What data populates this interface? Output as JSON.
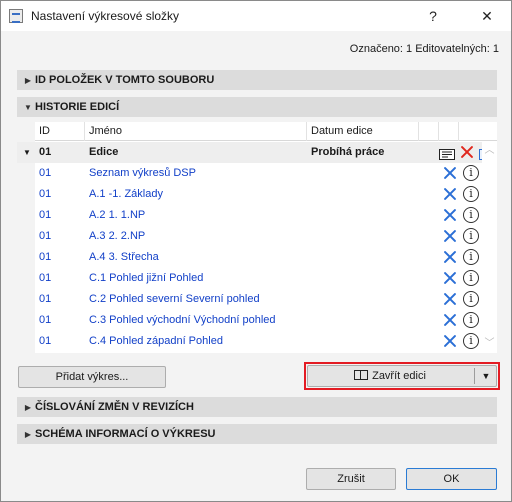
{
  "window": {
    "title": "Nastavení výkresové složky",
    "help_label": "?",
    "close_label": "✕"
  },
  "status": {
    "counts": "Označeno: 1 Editovatelných: 1"
  },
  "sections": {
    "id_items": "ID POLOŽEK V TOMTO SOUBORU",
    "history": "HISTORIE EDICÍ",
    "numbering": "ČÍSLOVÁNÍ ZMĚN V REVIZÍCH",
    "schema": "SCHÉMA INFORMACÍ O VÝKRESU"
  },
  "table": {
    "headers": {
      "id": "ID",
      "name": "Jméno",
      "date": "Datum edice"
    },
    "group": {
      "id": "01",
      "name": "Edice",
      "status": "Probíhá práce"
    },
    "rows": [
      {
        "id": "01",
        "name": "Seznam výkresů DSP"
      },
      {
        "id": "01",
        "name": "A.1 -1. Základy"
      },
      {
        "id": "01",
        "name": "A.2 1. 1.NP"
      },
      {
        "id": "01",
        "name": "A.3 2. 2.NP"
      },
      {
        "id": "01",
        "name": "A.4 3. Střecha"
      },
      {
        "id": "01",
        "name": "C.1 Pohled jižní Pohled"
      },
      {
        "id": "01",
        "name": "C.2 Pohled severní Severní pohled"
      },
      {
        "id": "01",
        "name": "C.3 Pohled východní Východní pohled"
      },
      {
        "id": "01",
        "name": "C.4 Pohled západní Pohled"
      }
    ]
  },
  "buttons": {
    "add_drawing": "Přidat výkres...",
    "close_edition": "Zavřít edici",
    "cancel": "Zrušit",
    "ok": "OK"
  },
  "icons": {
    "remove": "remove-x-icon",
    "info": "info-icon",
    "issue": "issue-icon",
    "list": "list-icon"
  },
  "colors": {
    "link_blue": "#1240c8",
    "icon_blue": "#2b6fd6",
    "delete_red": "#e0281e",
    "highlight_red": "#e31b23"
  }
}
